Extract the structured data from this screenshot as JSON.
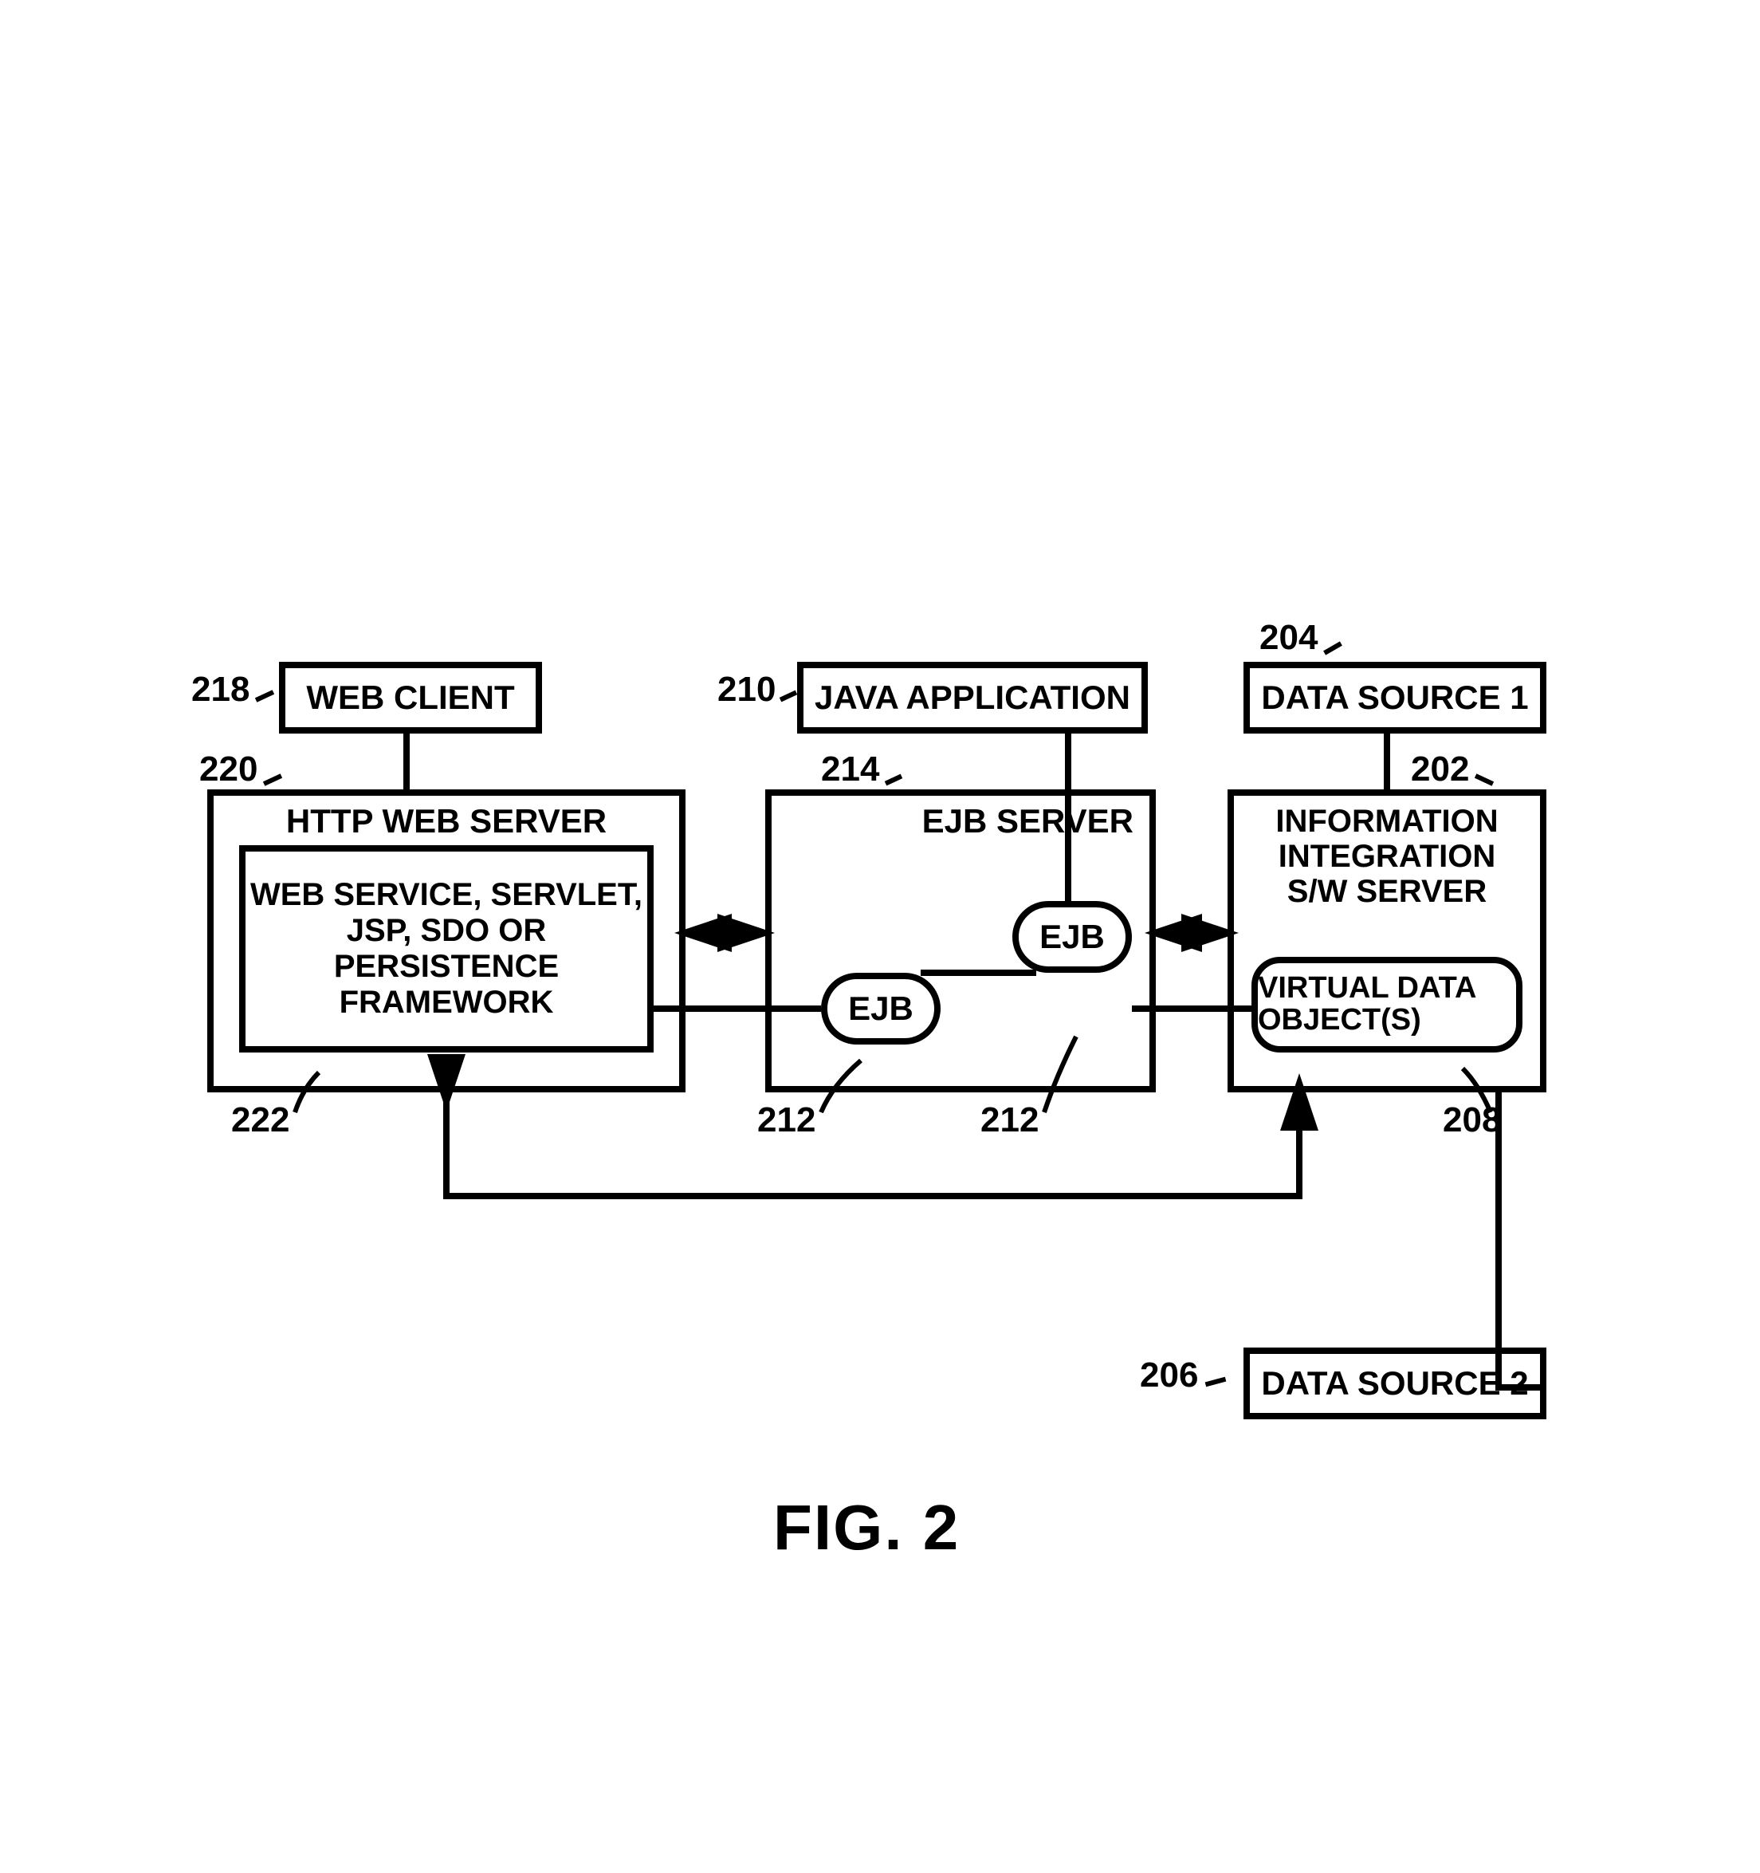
{
  "figure_label": "FIG. 2",
  "boxes": {
    "web_client": {
      "label": "WEB CLIENT",
      "ref": "218"
    },
    "java_app": {
      "label": "JAVA APPLICATION",
      "ref": "210"
    },
    "data_source_1": {
      "label": "DATA SOURCE 1",
      "ref": "204"
    },
    "http_server": {
      "title": "HTTP WEB SERVER",
      "ref": "220"
    },
    "web_service": {
      "label": "WEB SERVICE, SERVLET, JSP, SDO OR PERSISTENCE FRAMEWORK",
      "ref": "222"
    },
    "ejb_server": {
      "title": "EJB SERVER",
      "ref": "214"
    },
    "ejb1": {
      "label": "EJB",
      "ref": "212"
    },
    "ejb2": {
      "label": "EJB",
      "ref": "212"
    },
    "info_server": {
      "title": "INFORMATION INTEGRATION S/W SERVER",
      "ref": "202"
    },
    "virtual_data": {
      "label": "VIRTUAL DATA OBJECT(S)",
      "ref": "208"
    },
    "data_source_2": {
      "label": "DATA SOURCE 2",
      "ref": "206"
    }
  }
}
